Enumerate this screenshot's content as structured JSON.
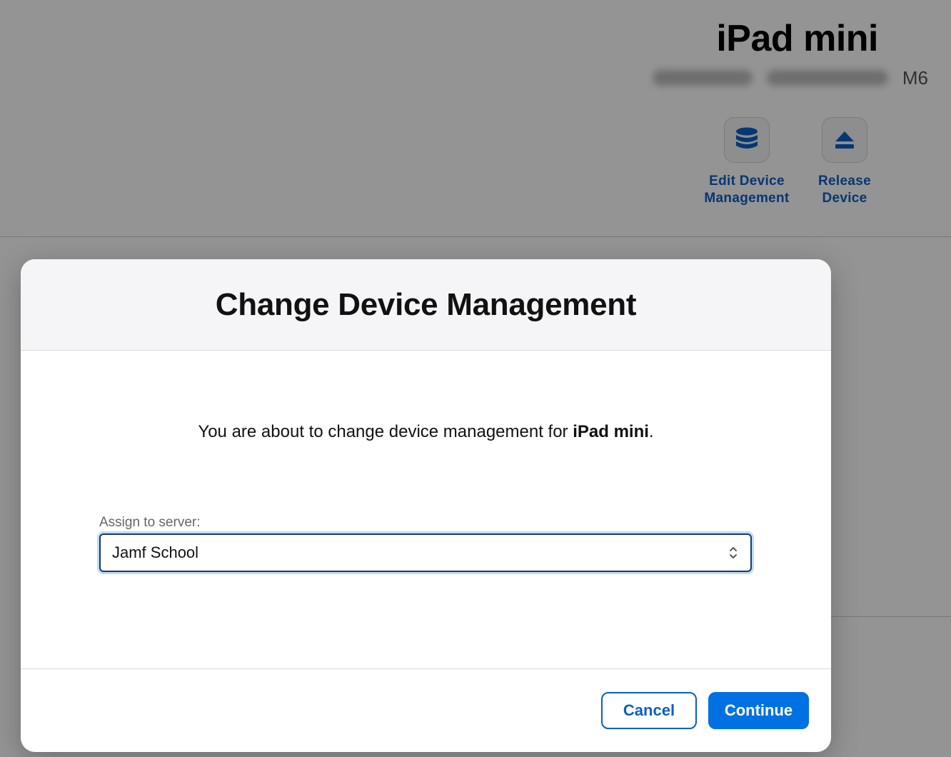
{
  "device": {
    "name": "iPad mini",
    "model_suffix": "M6"
  },
  "actions": [
    {
      "icon": "database-icon",
      "label_line1": "Edit Device",
      "label_line2": "Management"
    },
    {
      "icon": "eject-icon",
      "label_line1": "Release",
      "label_line2": "Device"
    }
  ],
  "modal": {
    "title": "Change Device Management",
    "message_prefix": "You are about to change device management for ",
    "message_device": "iPad mini",
    "message_suffix": ".",
    "field_label": "Assign to server:",
    "selected_server": "Jamf School",
    "cancel_label": "Cancel",
    "continue_label": "Continue"
  },
  "colors": {
    "accent": "#0071e3",
    "link": "#0a5fc4"
  }
}
